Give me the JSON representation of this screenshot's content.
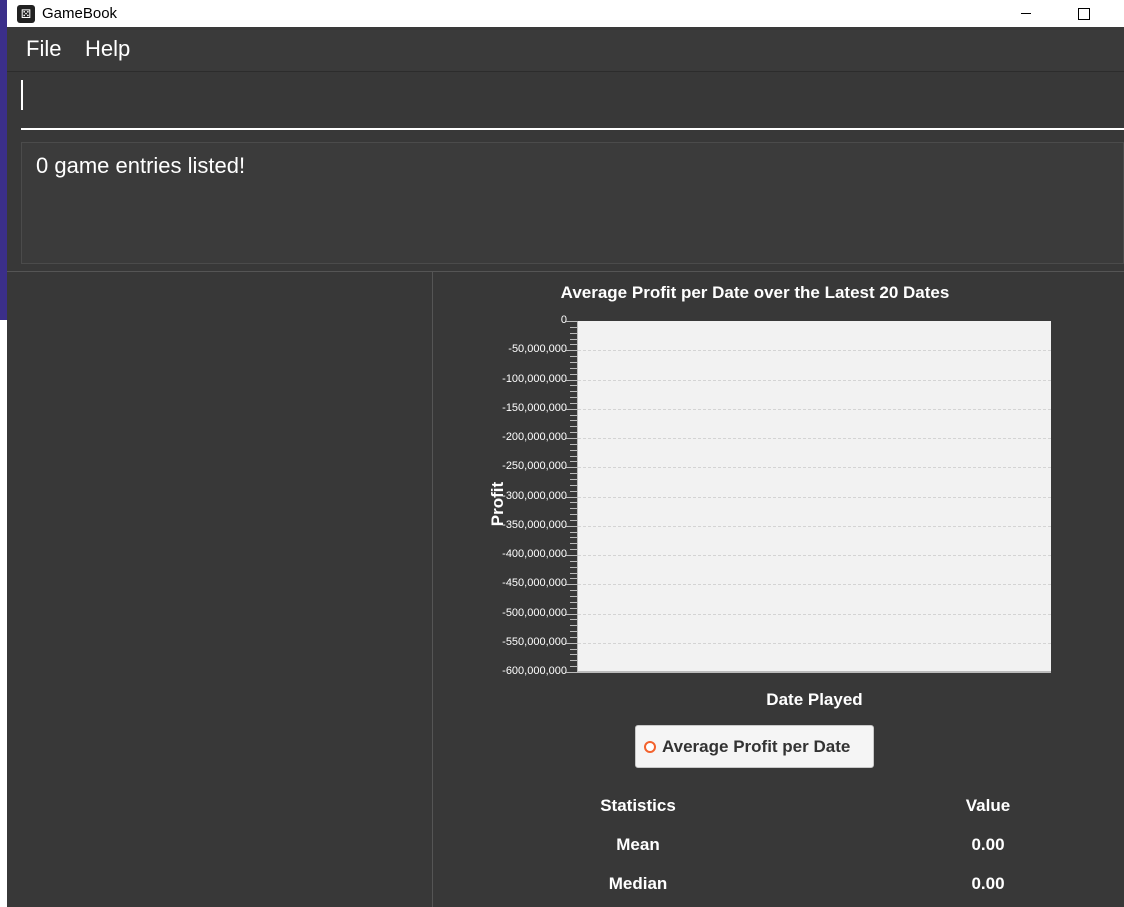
{
  "window": {
    "title": "GameBook"
  },
  "menu": {
    "file": "File",
    "help": "Help"
  },
  "command": {
    "value": ""
  },
  "result": {
    "message": "0 game entries listed!"
  },
  "chart_data": {
    "type": "line",
    "title": "Average Profit per Date over the Latest 20 Dates",
    "xlabel": "Date Played",
    "ylabel": "Profit",
    "ylim": [
      -600000000,
      0
    ],
    "yticks": [
      "0",
      "-50,000,000",
      "-100,000,000",
      "-150,000,000",
      "-200,000,000",
      "-250,000,000",
      "-300,000,000",
      "-350,000,000",
      "-400,000,000",
      "-450,000,000",
      "-500,000,000",
      "-550,000,000",
      "-600,000,000"
    ],
    "series": [
      {
        "name": "Average Profit per Date",
        "values": []
      }
    ],
    "grid": true,
    "legend": "bottom",
    "series_color": "#f3622d"
  },
  "statistics": {
    "header": {
      "stat": "Statistics",
      "value": "Value"
    },
    "rows": [
      {
        "label": "Mean",
        "value": "0.00"
      },
      {
        "label": "Median",
        "value": "0.00"
      }
    ]
  }
}
